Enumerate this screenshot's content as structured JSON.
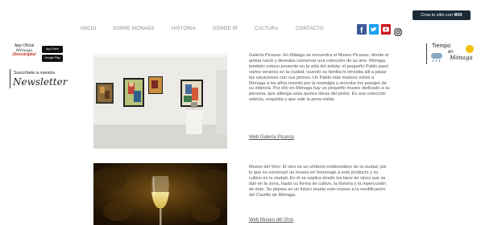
{
  "wix_badge": {
    "prefix": "Crea tu sitio con",
    "brand": "WiX"
  },
  "nav": {
    "items": [
      "INICIO",
      "SOBRE MÓNAGA",
      "HISTORIA",
      "DÓNDE IR",
      "CULTURA",
      "CONTACTO"
    ]
  },
  "social": {
    "icons": [
      "facebook-icon",
      "twitter-icon",
      "youtube-icon",
      "instagram-icon"
    ],
    "colors": {
      "facebook": "#3b5998",
      "twitter": "#1da1f2",
      "youtube": "#cc181e"
    }
  },
  "app_promo": {
    "line1": "App Oficial",
    "line2": "Mónaga",
    "line3": "¡Descárgala!",
    "store1": "App Store",
    "store2": "Google Play"
  },
  "newsletter": {
    "small": "Suscríbete a nuestra",
    "big": "Newsletter"
  },
  "weather": {
    "title": "Tiempo",
    "en": "en",
    "brand": "Mónaga"
  },
  "articles": [
    {
      "text": "Galería Picasso: En Málaga se encuentra el Museo Picasso, donde el artista nació y deseaba conservar una colección de su arte. Mónaga también estuvo presente en la vida del artista: el pequeño Pablo pasó varios veranos en la ciudad, cuando su familia lo enviaba allí a pasar las vacaciones con sus primos. Un Pablo más maduro volvió a Mónaga a los años movido por la nostalgia a recordar los pasajes de su infancia. Por ello en Mónaga hay un pequeño museo dedicado a su persona, que alberga unas quince obras del pintor. Es una colección selecta, exquisita y que vale la pena visitar.",
      "link": "Web Galería Picasso"
    },
    {
      "text": "Museo del Vino: El vino es un símbolo emblemático de la ciudad, por lo que se construyó un museo en homenaje a este producto y su cultivo en la ciudad. En él se explica desde los tipos de vinos que se dan en la zona, hasta su forma de cultivo, la historia y la repercusión de éste. Se planea en un futuro mudar este museo a la reedificación del Castillo de Mónaga.",
      "link": "Web Museo del Vino"
    }
  ]
}
